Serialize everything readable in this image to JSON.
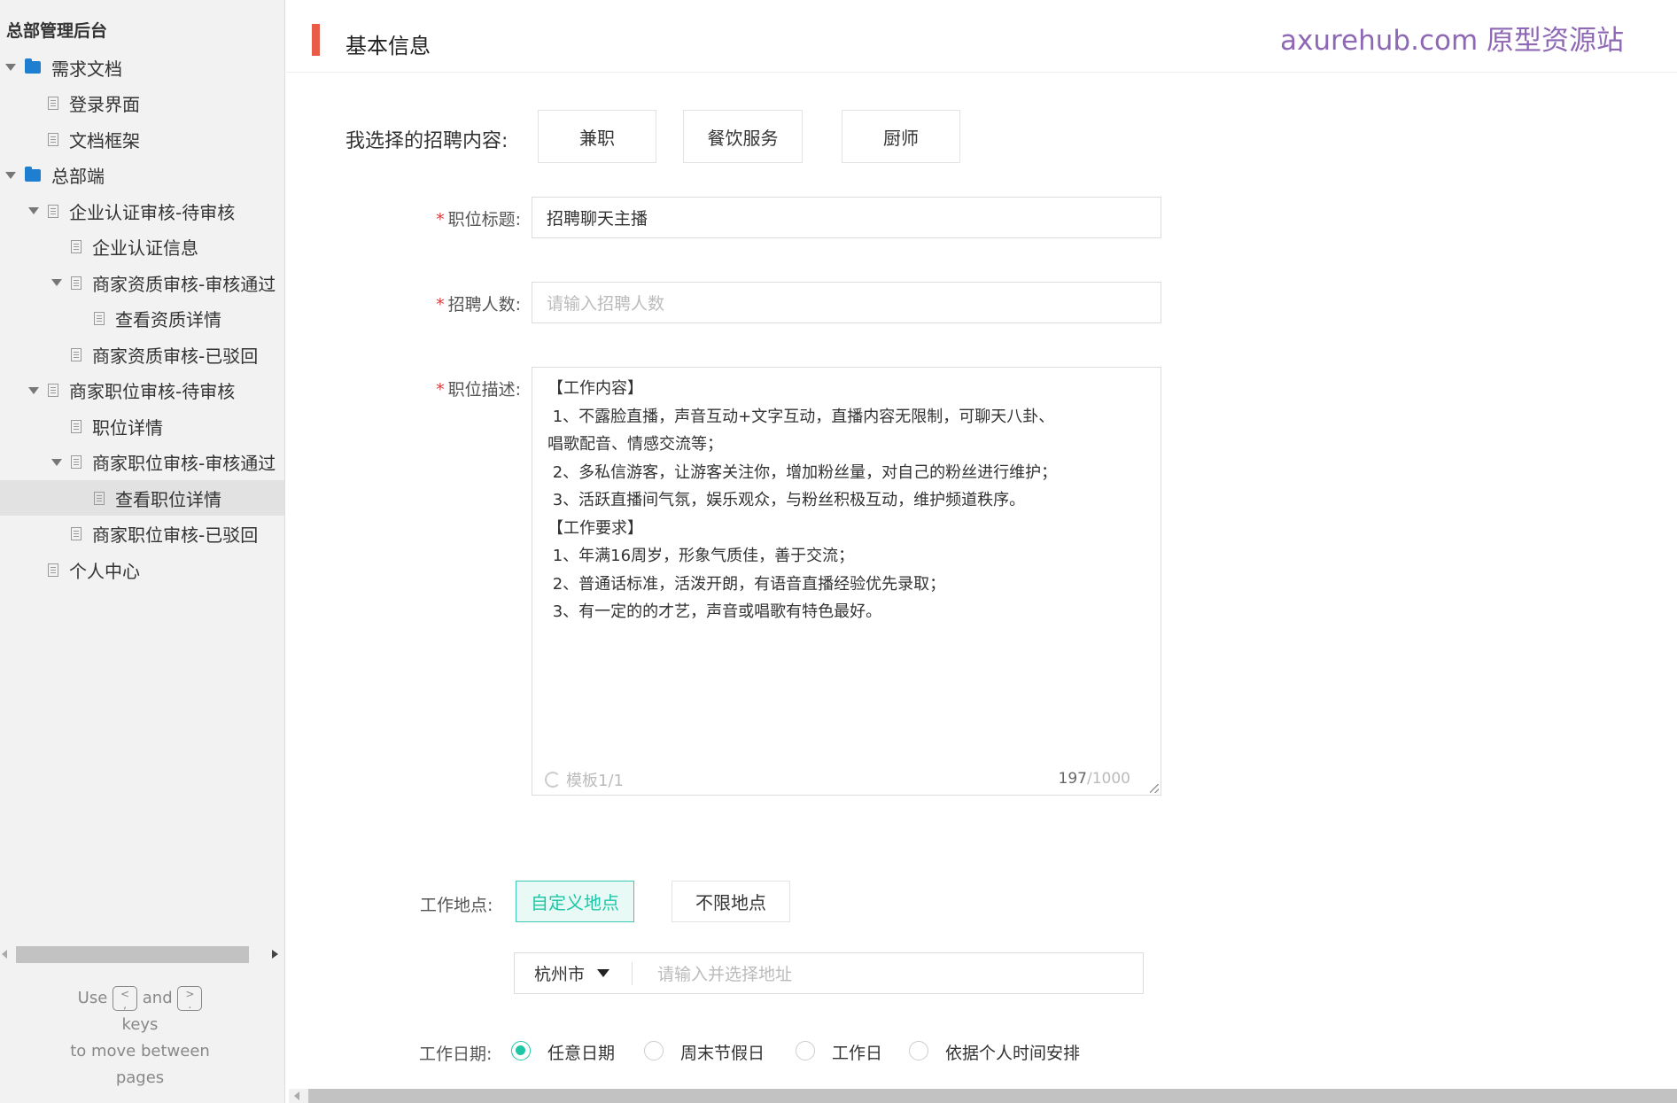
{
  "sidebar": {
    "title": "总部管理后台",
    "items": [
      {
        "label": "需求文档",
        "level": 0,
        "type": "folder",
        "expanded": true
      },
      {
        "label": "登录界面",
        "level": 1,
        "type": "page"
      },
      {
        "label": "文档框架",
        "level": 1,
        "type": "page"
      },
      {
        "label": "总部端",
        "level": 0,
        "type": "folder",
        "expanded": true
      },
      {
        "label": "企业认证审核-待审核",
        "level": 1,
        "type": "page",
        "expanded": true
      },
      {
        "label": "企业认证信息",
        "level": 2,
        "type": "page"
      },
      {
        "label": "商家资质审核-审核通过",
        "level": 2,
        "type": "page",
        "expanded": true
      },
      {
        "label": "查看资质详情",
        "level": 3,
        "type": "page"
      },
      {
        "label": "商家资质审核-已驳回",
        "level": 2,
        "type": "page"
      },
      {
        "label": "商家职位审核-待审核",
        "level": 1,
        "type": "page",
        "expanded": true
      },
      {
        "label": "职位详情",
        "level": 2,
        "type": "page"
      },
      {
        "label": "商家职位审核-审核通过",
        "level": 2,
        "type": "page",
        "expanded": true
      },
      {
        "label": "查看职位详情",
        "level": 3,
        "type": "page",
        "selected": true
      },
      {
        "label": "商家职位审核-已驳回",
        "level": 2,
        "type": "page"
      },
      {
        "label": "个人中心",
        "level": 1,
        "type": "page"
      }
    ],
    "help": {
      "use": "Use",
      "key_prev_top": "<",
      "key_prev_bottom": ",",
      "and": "and",
      "key_next_top": ">",
      "key_next_bottom": ".",
      "keys": "keys",
      "move": "to move between",
      "pages": "pages"
    }
  },
  "header": {
    "title": "基本信息",
    "watermark": "axurehub.com 原型资源站"
  },
  "form": {
    "selected_label": "我选择的招聘内容:",
    "tags": [
      "兼职",
      "餐饮服务",
      "厨师"
    ],
    "title_label": "职位标题:",
    "title_value": "招聘聊天主播",
    "count_label": "招聘人数:",
    "count_placeholder": "请输入招聘人数",
    "desc_label": "职位描述:",
    "desc_value": "【工作内容】\n 1、不露脸直播，声音互动+文字互动，直播内容无限制，可聊天八卦、\n唱歌配音、情感交流等；\n 2、多私信游客，让游客关注你，增加粉丝量，对自己的粉丝进行维护；\n 3、活跃直播间气氛，娱乐观众，与粉丝积极互动，维护频道秩序。\n【工作要求】\n 1、年满16周岁，形象气质佳，善于交流；\n 2、普通话标准，活泼开朗，有语音直播经验优先录取；\n 3、有一定的的才艺，声音或唱歌有特色最好。",
    "template": "模板1/1",
    "count_current": "197",
    "count_max": "/1000",
    "location_label": "工作地点:",
    "location_options": [
      "自定义地点",
      "不限地点"
    ],
    "location_selected": "自定义地点",
    "city": "杭州市",
    "address_placeholder": "请输入并选择地址",
    "date_label": "工作日期:",
    "date_options": [
      "任意日期",
      "周末节假日",
      "工作日",
      "依据个人时间安排"
    ],
    "date_selected": "任意日期"
  },
  "colors": {
    "accent": "#1fc6a5",
    "header_bar": "#e85d4a",
    "watermark": "#8e67b5",
    "required": "#e5393b",
    "folder": "#1e7fd0"
  }
}
